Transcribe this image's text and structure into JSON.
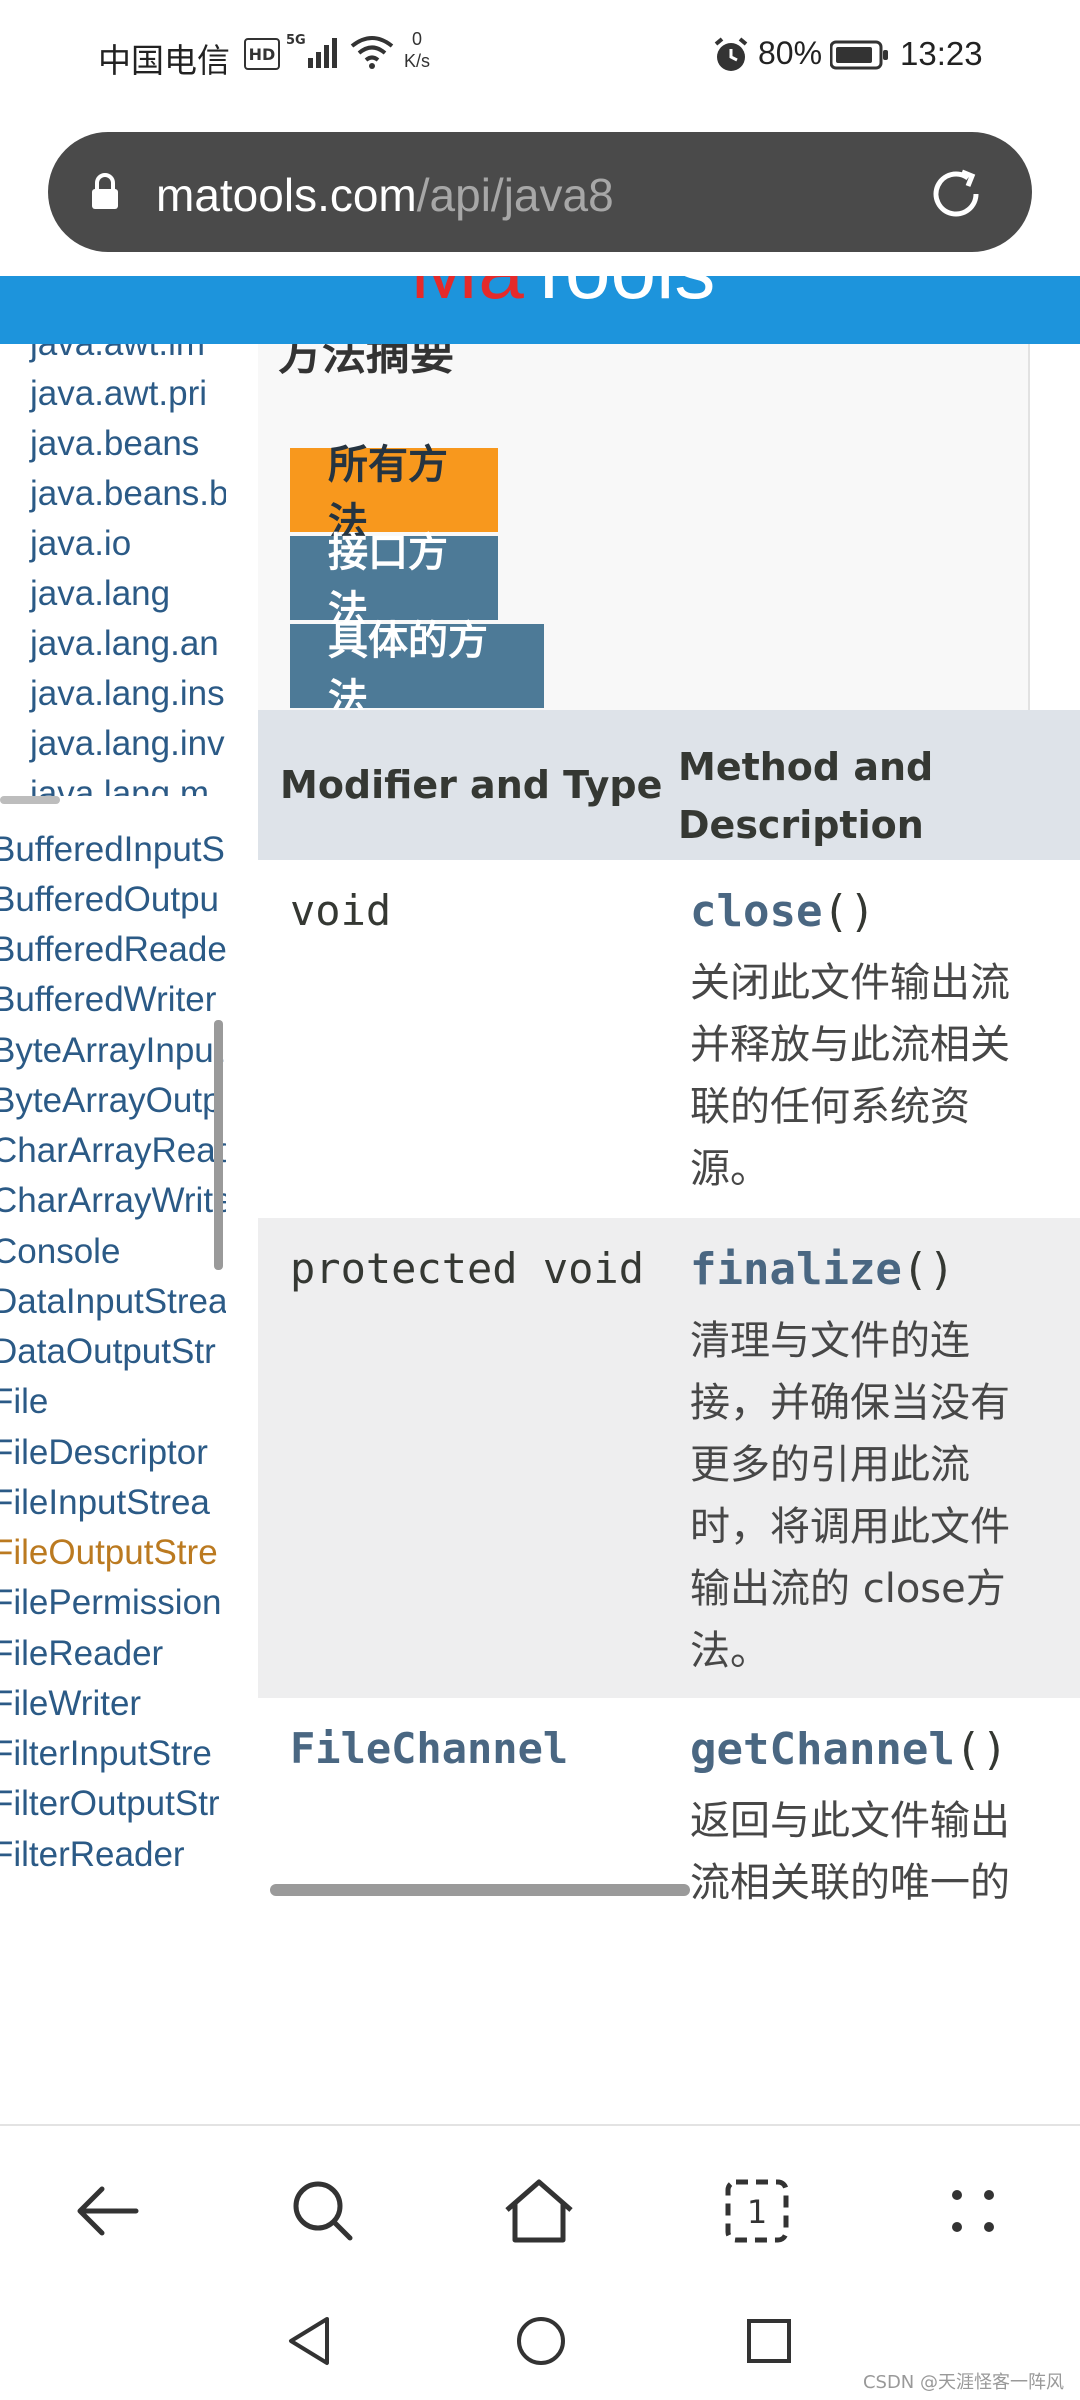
{
  "status_bar": {
    "carrier": "中国电信",
    "hd": "HD",
    "network": "5G",
    "speed_value": "0",
    "speed_unit": "K/s",
    "battery": "80%",
    "time": "13:23"
  },
  "browser": {
    "url_domain": "matools.com",
    "url_path": "/api/java8"
  },
  "site": {
    "logo_ma": "Ma",
    "logo_tools": "Tools"
  },
  "packages": [
    "java.awt.im",
    "java.awt.pri",
    "java.beans",
    "java.beans.b",
    "java.io",
    "java.lang",
    "java.lang.an",
    "java.lang.ins",
    "java.lang.inv",
    "java.lang.m"
  ],
  "classes": [
    "BufferedInputS",
    "BufferedOutpu",
    "BufferedReade",
    "BufferedWriter",
    "ByteArrayInput",
    "ByteArrayOutp",
    "CharArrayRead",
    "CharArrayWrite",
    "Console",
    "DataInputStrea",
    "DataOutputStr",
    "File",
    "FileDescriptor",
    "FileInputStrea",
    "FileOutputStre",
    "FilePermission",
    "FileReader",
    "FileWriter",
    "FilterInputStre",
    "FilterOutputStr",
    "FilterReader"
  ],
  "active_class": "FileOutputStre",
  "summary": {
    "title": "方法摘要",
    "tabs": [
      "所有方法",
      "接口方法",
      "具体的方法"
    ],
    "active_tab": "所有方法"
  },
  "method_table": {
    "headers": [
      "Modifier and Type",
      "Method and",
      "Description"
    ],
    "rows": [
      {
        "type": "void",
        "type_is_link": false,
        "method": "close",
        "params": "()",
        "desc": [
          "关闭此文件输出流",
          "并释放与此流相关",
          "联的任何系统资",
          "源。"
        ]
      },
      {
        "type": "protected void",
        "type_is_link": false,
        "method": "finalize",
        "params": "()",
        "desc": [
          "清理与文件的连",
          "接，并确保当没有",
          "更多的引用此流",
          "时，将调用此文件",
          "输出流的 close方",
          "法。"
        ]
      },
      {
        "type": "FileChannel",
        "type_is_link": true,
        "method": "getChannel",
        "params": "()",
        "desc": [
          "返回与此文件输出",
          "流相关联的唯一的"
        ]
      }
    ]
  },
  "watermark": "CSDN @天涯怪客一阵风",
  "colors": {
    "header_blue": "#1d94dc",
    "tab_active": "#f8981d",
    "tab_inactive": "#4d7a97",
    "link": "#4a6782",
    "active_class": "#bb7a20"
  }
}
